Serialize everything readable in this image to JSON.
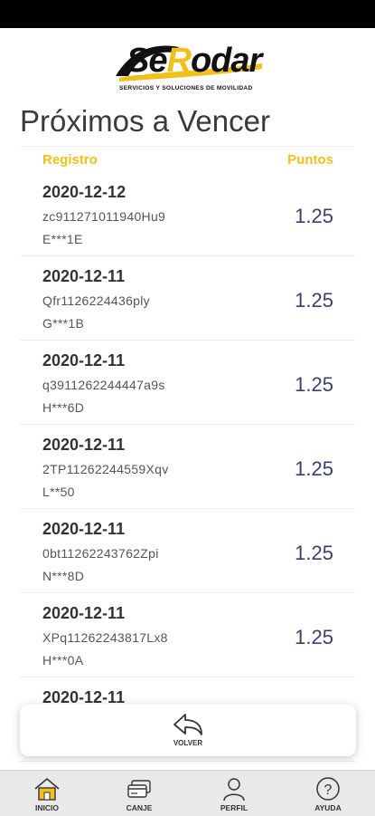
{
  "logo": {
    "word": "SeRodar",
    "tagline": "SERVICIOS Y SOLUCIONES DE MOVILIDAD"
  },
  "page": {
    "title": "Próximos a Vencer"
  },
  "table": {
    "headers": {
      "registro": "Registro",
      "puntos": "Puntos"
    },
    "rows": [
      {
        "date": "2020-12-12",
        "code": "zc911271011940Hu9",
        "plate": "E***1E",
        "points": "1.25"
      },
      {
        "date": "2020-12-11",
        "code": "Qfr1126224436ply",
        "plate": "G***1B",
        "points": "1.25"
      },
      {
        "date": "2020-12-11",
        "code": "q3911262244447a9s",
        "plate": "H***6D",
        "points": "1.25"
      },
      {
        "date": "2020-12-11",
        "code": "2TP11262244559Xqv",
        "plate": "L**50",
        "points": "1.25"
      },
      {
        "date": "2020-12-11",
        "code": "0bt11262243762Zpi",
        "plate": "N***8D",
        "points": "1.25"
      },
      {
        "date": "2020-12-11",
        "code": "XPq11262243817Lx8",
        "plate": "H***0A",
        "points": "1.25"
      },
      {
        "date": "2020-12-11",
        "code": "",
        "plate": "",
        "points": ""
      }
    ]
  },
  "back_button": {
    "label": "VOLVER",
    "icon": "back-arrow-icon"
  },
  "nav": {
    "items": [
      {
        "label": "INICIO",
        "icon": "home-icon"
      },
      {
        "label": "CANJE",
        "icon": "card-icon"
      },
      {
        "label": "PERFIL",
        "icon": "user-icon"
      },
      {
        "label": "AYUDA",
        "icon": "help-icon"
      }
    ]
  },
  "colors": {
    "accent": "#f2c01a",
    "points": "#3b3f6b",
    "status_bar": "#000000",
    "nav_bg": "#e9e9e9"
  }
}
